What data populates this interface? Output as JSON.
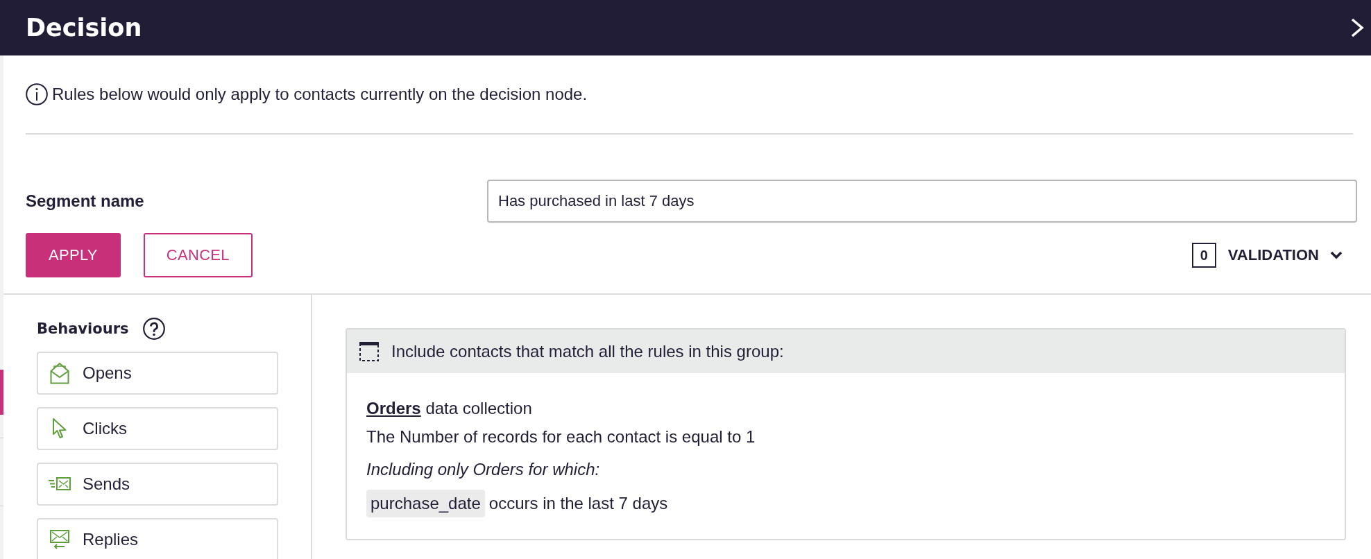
{
  "header": {
    "title": "Decision"
  },
  "notice": {
    "text": "Rules below would only apply to contacts currently on the decision node."
  },
  "segment_name": {
    "label": "Segment name",
    "value": "Has purchased in last 7 days"
  },
  "actions": [
    {
      "label": "APPLY",
      "kind": "primary"
    },
    {
      "label": "CANCEL",
      "kind": "secondary"
    }
  ],
  "validation": {
    "count": "0",
    "label": "VALIDATION",
    "expanded": false
  },
  "behaviours": {
    "title": "Behaviours",
    "items": [
      {
        "label": "Opens",
        "kind": "opens"
      },
      {
        "label": "Clicks",
        "kind": "clicks"
      },
      {
        "label": "Sends",
        "kind": "sends"
      },
      {
        "label": "Replies",
        "kind": "replies"
      }
    ]
  },
  "rule_group": {
    "header": "Include contacts that match all the rules in this group:",
    "rule": {
      "collection_link": "Orders",
      "collection_text": "data collection",
      "condition": "The Number of records for each contact is equal to 1",
      "filter_intro": "Including only Orders for which:",
      "field": "purchase_date",
      "field_condition": "occurs in the last 7 days"
    }
  }
}
